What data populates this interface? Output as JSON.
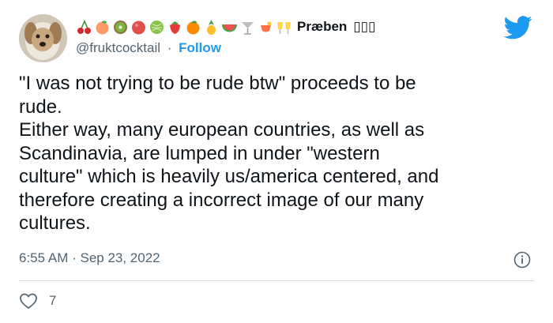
{
  "tweet": {
    "display_name": "Præben",
    "name_suffix": "▯▯▯",
    "name_emojis": [
      "cherries-icon",
      "peach-icon",
      "kiwi-icon",
      "plum-icon",
      "melon-icon",
      "strawberry-icon",
      "tangerine-icon",
      "pineapple-icon",
      "watermelon-icon",
      "cocktail-glass-icon",
      "tropical-drink-icon",
      "clinking-glasses-icon"
    ],
    "handle": "@fruktcocktail",
    "separator": "·",
    "follow_label": "Follow",
    "text": "\"I was not trying to be rude btw\" proceeds to be\nrude.\nEither way, many european countries, as well as\nScandinavia, are lumped in under \"western\nculture\" which is heavily us/america centered, and\ntherefore creating a incorrect image of our many\ncultures.",
    "timestamp": "6:55 AM · Sep 23, 2022",
    "like_count": "7"
  },
  "colors": {
    "brand": "#1d9bf0",
    "text": "#0f1419",
    "secondary": "#536471",
    "divider": "#cfd9de"
  }
}
